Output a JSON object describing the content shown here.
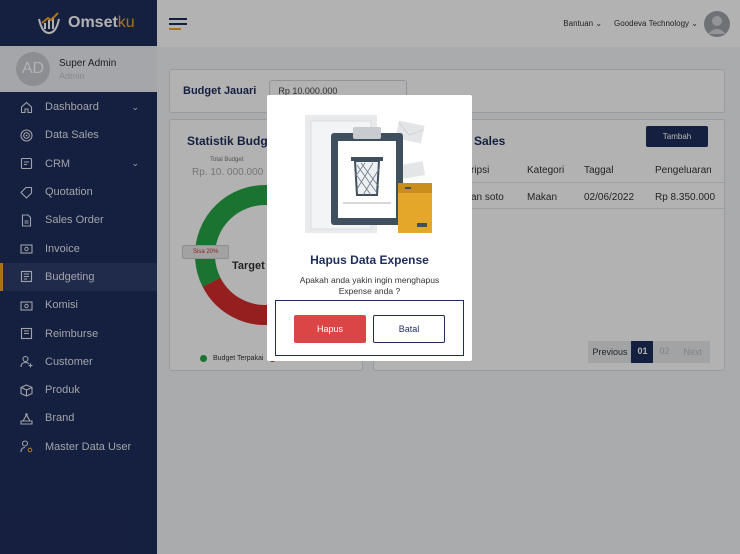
{
  "brand": {
    "name_main": "Omset",
    "name_accent": "ku"
  },
  "profile": {
    "initials": "AD",
    "name": "Super Admin",
    "role": "Admin"
  },
  "nav": [
    {
      "label": "Dashboard",
      "icon": "home-icon",
      "caret": true
    },
    {
      "label": "Data Sales",
      "icon": "target-icon"
    },
    {
      "label": "CRM",
      "icon": "crm-icon",
      "caret": true
    },
    {
      "label": "Quotation",
      "icon": "tag-icon"
    },
    {
      "label": "Sales Order",
      "icon": "document-icon"
    },
    {
      "label": "Invoice",
      "icon": "invoice-icon"
    },
    {
      "label": "Budgeting",
      "icon": "budget-icon",
      "active": true
    },
    {
      "label": "Komisi",
      "icon": "commission-icon"
    },
    {
      "label": "Reimburse",
      "icon": "reimburse-icon"
    },
    {
      "label": "Customer",
      "icon": "user-add-icon"
    },
    {
      "label": "Produk",
      "icon": "box-icon"
    },
    {
      "label": "Brand",
      "icon": "brand-icon"
    },
    {
      "label": "Master Data User",
      "icon": "user-settings-icon"
    }
  ],
  "topbar": {
    "help": "Bantuan",
    "company": "Goodeva Technology"
  },
  "budget": {
    "label": "Budget Jauari",
    "value": "Rp 10.000.000"
  },
  "stat": {
    "title": "Statistik Budge",
    "total_label": "Total Budget",
    "total_value": "Rp. 10. 000.000",
    "sisa": "Sisa 20%",
    "target": "Target",
    "legend": "Budget Terpakai"
  },
  "chart_data": {
    "type": "pie",
    "categories": [
      "Budget Terpakai",
      "Sisa"
    ],
    "values": [
      80,
      20
    ],
    "colors": [
      "#27a547",
      "#d62b2b"
    ]
  },
  "table": {
    "title": "Sales",
    "add_label": "Tambah",
    "headers": [
      "kripsi",
      "Kategori",
      "Taggal",
      "Pengeluaran"
    ],
    "rows": [
      [
        "kan soto",
        "Makan",
        "02/06/2022",
        "Rp 8.350.000"
      ]
    ]
  },
  "pager": {
    "prev": "Previous",
    "current": "01",
    "next_num": "02",
    "next": "Next"
  },
  "modal": {
    "title": "Hapus Data Expense",
    "message": "Apakah anda yakin ingin menghapus Expense anda ?",
    "confirm": "Hapus",
    "cancel": "Batal"
  }
}
